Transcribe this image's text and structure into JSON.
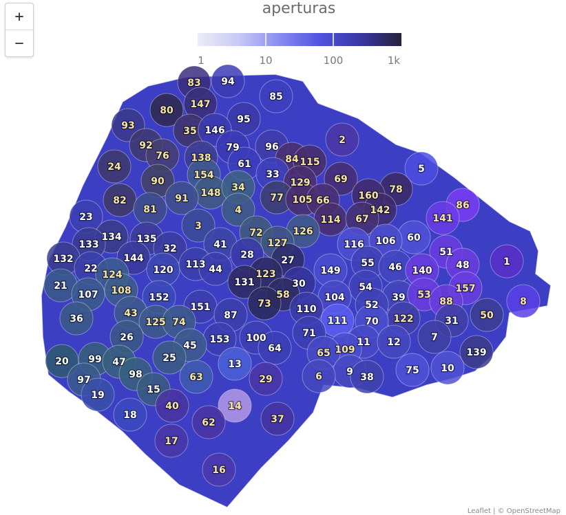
{
  "zoom": {
    "in_label": "+",
    "out_label": "−"
  },
  "legend": {
    "title": "aperturas",
    "ticks": [
      "1",
      "10",
      "100",
      "1k"
    ],
    "colors": [
      "#ececf8",
      "#c9c9f4",
      "#8a8cf2",
      "#4f52de",
      "#3a36a2",
      "#26213a"
    ]
  },
  "attribution": "Leaflet | © OpenStreetMap",
  "map": {
    "boundary_color": "#3c3fc4",
    "districts": [
      {
        "label": "83",
        "fill": "#3b2e7e",
        "tc": "#f7e6a0"
      },
      {
        "label": "94",
        "fill": "#3d3cb4",
        "tc": "#ffffff"
      },
      {
        "label": "85",
        "fill": "#3d3fbe",
        "tc": "#ffffff"
      },
      {
        "label": "147",
        "fill": "#3a2f78",
        "tc": "#f7e6a0"
      },
      {
        "label": "80",
        "fill": "#2f2a4e",
        "tc": "#f7e6a0"
      },
      {
        "label": "95",
        "fill": "#3a3aa8",
        "tc": "#ffffff"
      },
      {
        "label": "93",
        "fill": "#3a3a8c",
        "tc": "#f7e6a0"
      },
      {
        "label": "35",
        "fill": "#3e356a",
        "tc": "#f7e6a0"
      },
      {
        "label": "146",
        "fill": "#3b3ab0",
        "tc": "#ffffff"
      },
      {
        "label": "2",
        "fill": "#4c36a6",
        "tc": "#f7e6a0"
      },
      {
        "label": "92",
        "fill": "#403a6e",
        "tc": "#f7e6a0"
      },
      {
        "label": "79",
        "fill": "#3a3ab4",
        "tc": "#ffffff"
      },
      {
        "label": "96",
        "fill": "#3f3caa",
        "tc": "#ffffff"
      },
      {
        "label": "76",
        "fill": "#454070",
        "tc": "#f7e6a0"
      },
      {
        "label": "138",
        "fill": "#3d3f8e",
        "tc": "#f7e6a0"
      },
      {
        "label": "84",
        "fill": "#4a2f6e",
        "tc": "#f7e6a0"
      },
      {
        "label": "115",
        "fill": "#482e6a",
        "tc": "#f7e6a0"
      },
      {
        "label": "61",
        "fill": "#3c3dba",
        "tc": "#ffffff"
      },
      {
        "label": "24",
        "fill": "#3e3a6a",
        "tc": "#f7e6a0"
      },
      {
        "label": "33",
        "fill": "#3d40bc",
        "tc": "#ffffff"
      },
      {
        "label": "5",
        "fill": "#4a4ee0",
        "tc": "#ffffff"
      },
      {
        "label": "154",
        "fill": "#3f5a8e",
        "tc": "#f7e6a0"
      },
      {
        "label": "90",
        "fill": "#424264",
        "tc": "#f7e6a0"
      },
      {
        "label": "69",
        "fill": "#472e72",
        "tc": "#f7e6a0"
      },
      {
        "label": "129",
        "fill": "#4a2e6e",
        "tc": "#f7e6a0"
      },
      {
        "label": "148",
        "fill": "#3f5c80",
        "tc": "#f7e6a0"
      },
      {
        "label": "34",
        "fill": "#3e6384",
        "tc": "#f7e6a0"
      },
      {
        "label": "78",
        "fill": "#3a2a66",
        "tc": "#f7e6a0"
      },
      {
        "label": "91",
        "fill": "#40508c",
        "tc": "#f7e6a0"
      },
      {
        "label": "160",
        "fill": "#3f2c6a",
        "tc": "#f7e6a0"
      },
      {
        "label": "77",
        "fill": "#3d4070",
        "tc": "#f7e6a0"
      },
      {
        "label": "105",
        "fill": "#4a2f6e",
        "tc": "#f7e6a0"
      },
      {
        "label": "66",
        "fill": "#4a2f70",
        "tc": "#f7e6a0"
      },
      {
        "label": "82",
        "fill": "#3e3a66",
        "tc": "#f7e6a0"
      },
      {
        "label": "86",
        "fill": "#7a3cf2",
        "tc": "#f7e6a0"
      },
      {
        "label": "142",
        "fill": "#402c6c",
        "tc": "#f7e6a0"
      },
      {
        "label": "81",
        "fill": "#3e4c8a",
        "tc": "#f7e6a0"
      },
      {
        "label": "4",
        "fill": "#3e5c84",
        "tc": "#f7e6a0"
      },
      {
        "label": "23",
        "fill": "#3a40b0",
        "tc": "#ffffff"
      },
      {
        "label": "114",
        "fill": "#4a2f6e",
        "tc": "#f7e6a0"
      },
      {
        "label": "67",
        "fill": "#473070",
        "tc": "#f7e6a0"
      },
      {
        "label": "141",
        "fill": "#6a3ce6",
        "tc": "#f7e6a0"
      },
      {
        "label": "3",
        "fill": "#3c4c96",
        "tc": "#f7e6a0"
      },
      {
        "label": "126",
        "fill": "#405a88",
        "tc": "#f7e6a0"
      },
      {
        "label": "72",
        "fill": "#405a7c",
        "tc": "#f7e6a0"
      },
      {
        "label": "134",
        "fill": "#3a3c8a",
        "tc": "#ffffff"
      },
      {
        "label": "135",
        "fill": "#3b3c96",
        "tc": "#ffffff"
      },
      {
        "label": "127",
        "fill": "#3f5680",
        "tc": "#f7e6a0"
      },
      {
        "label": "60",
        "fill": "#4f52d6",
        "tc": "#ffffff"
      },
      {
        "label": "116",
        "fill": "#4d50d2",
        "tc": "#ffffff"
      },
      {
        "label": "106",
        "fill": "#4b4ecc",
        "tc": "#ffffff"
      },
      {
        "label": "133",
        "fill": "#3a3c92",
        "tc": "#ffffff"
      },
      {
        "label": "41",
        "fill": "#3c46a6",
        "tc": "#ffffff"
      },
      {
        "label": "32",
        "fill": "#3b3da0",
        "tc": "#ffffff"
      },
      {
        "label": "28",
        "fill": "#3b3aa8",
        "tc": "#ffffff"
      },
      {
        "label": "51",
        "fill": "#6a3ce0",
        "tc": "#ffffff"
      },
      {
        "label": "1",
        "fill": "#5a2fc8",
        "tc": "#ffffff"
      },
      {
        "label": "132",
        "fill": "#3a3c90",
        "tc": "#ffffff"
      },
      {
        "label": "144",
        "fill": "#3a3a9a",
        "tc": "#ffffff"
      },
      {
        "label": "27",
        "fill": "#2e2c6a",
        "tc": "#ffffff"
      },
      {
        "label": "55",
        "fill": "#3f42b6",
        "tc": "#ffffff"
      },
      {
        "label": "46",
        "fill": "#4346c0",
        "tc": "#ffffff"
      },
      {
        "label": "48",
        "fill": "#6a3cde",
        "tc": "#ffffff"
      },
      {
        "label": "22",
        "fill": "#3a40a8",
        "tc": "#ffffff"
      },
      {
        "label": "120",
        "fill": "#3c48b2",
        "tc": "#ffffff"
      },
      {
        "label": "113",
        "fill": "#3b3eaa",
        "tc": "#ffffff"
      },
      {
        "label": "44",
        "fill": "#3b3eae",
        "tc": "#ffffff"
      },
      {
        "label": "149",
        "fill": "#4a4ed0",
        "tc": "#ffffff"
      },
      {
        "label": "140",
        "fill": "#6a3ce0",
        "tc": "#ffffff"
      },
      {
        "label": "124",
        "fill": "#3c5c8e",
        "tc": "#f7e6a0"
      },
      {
        "label": "123",
        "fill": "#2d2c60",
        "tc": "#f7e6a0"
      },
      {
        "label": "21",
        "fill": "#3a5a8a",
        "tc": "#ffffff"
      },
      {
        "label": "131",
        "fill": "#2e2c62",
        "tc": "#ffffff"
      },
      {
        "label": "30",
        "fill": "#35349a",
        "tc": "#ffffff"
      },
      {
        "label": "54",
        "fill": "#3f42b8",
        "tc": "#ffffff"
      },
      {
        "label": "157",
        "fill": "#6a3ce0",
        "tc": "#f7e6a0"
      },
      {
        "label": "108",
        "fill": "#3d5e8c",
        "tc": "#f7e6a0"
      },
      {
        "label": "107",
        "fill": "#3a5c8c",
        "tc": "#ffffff"
      },
      {
        "label": "152",
        "fill": "#3b4ab8",
        "tc": "#ffffff"
      },
      {
        "label": "58",
        "fill": "#2e2c60",
        "tc": "#f7e6a0"
      },
      {
        "label": "104",
        "fill": "#4649c4",
        "tc": "#ffffff"
      },
      {
        "label": "39",
        "fill": "#4245b8",
        "tc": "#ffffff"
      },
      {
        "label": "53",
        "fill": "#6a3cde",
        "tc": "#f7e6a0"
      },
      {
        "label": "88",
        "fill": "#6a3cdc",
        "tc": "#f7e6a0"
      },
      {
        "label": "8",
        "fill": "#5a40e6",
        "tc": "#f7e6a0"
      },
      {
        "label": "73",
        "fill": "#2c2a5c",
        "tc": "#f7e6a0"
      },
      {
        "label": "52",
        "fill": "#4043b6",
        "tc": "#ffffff"
      },
      {
        "label": "110",
        "fill": "#3a3aa4",
        "tc": "#ffffff"
      },
      {
        "label": "151",
        "fill": "#3b3eae",
        "tc": "#ffffff"
      },
      {
        "label": "43",
        "fill": "#3c5a8c",
        "tc": "#f7e6a0"
      },
      {
        "label": "36",
        "fill": "#3a5a86",
        "tc": "#ffffff"
      },
      {
        "label": "87",
        "fill": "#3b3eac",
        "tc": "#ffffff"
      },
      {
        "label": "50",
        "fill": "#3c3d92",
        "tc": "#f7e6a0"
      },
      {
        "label": "125",
        "fill": "#3d5a88",
        "tc": "#f7e6a0"
      },
      {
        "label": "74",
        "fill": "#3d5a8c",
        "tc": "#f7e6a0"
      },
      {
        "label": "122",
        "fill": "#3f3fa8",
        "tc": "#f7e6a0"
      },
      {
        "label": "111",
        "fill": "#5b5ef0",
        "tc": "#ffffff"
      },
      {
        "label": "70",
        "fill": "#4a4dce",
        "tc": "#ffffff"
      },
      {
        "label": "31",
        "fill": "#3f40a4",
        "tc": "#ffffff"
      },
      {
        "label": "71",
        "fill": "#3c40b2",
        "tc": "#ffffff"
      },
      {
        "label": "26",
        "fill": "#3a5884",
        "tc": "#ffffff"
      },
      {
        "label": "7",
        "fill": "#3e3fa2",
        "tc": "#ffffff"
      },
      {
        "label": "153",
        "fill": "#3b3eb0",
        "tc": "#ffffff"
      },
      {
        "label": "100",
        "fill": "#3b3eb2",
        "tc": "#ffffff"
      },
      {
        "label": "45",
        "fill": "#3c5c8c",
        "tc": "#ffffff"
      },
      {
        "label": "11",
        "fill": "#4649c6",
        "tc": "#ffffff"
      },
      {
        "label": "12",
        "fill": "#4548c0",
        "tc": "#ffffff"
      },
      {
        "label": "64",
        "fill": "#3b3eb4",
        "tc": "#ffffff"
      },
      {
        "label": "139",
        "fill": "#3b3c8a",
        "tc": "#ffffff"
      },
      {
        "label": "109",
        "fill": "#4b4ed0",
        "tc": "#f7e6a0"
      },
      {
        "label": "65",
        "fill": "#4649c4",
        "tc": "#f7e6a0"
      },
      {
        "label": "25",
        "fill": "#3c5c84",
        "tc": "#ffffff"
      },
      {
        "label": "20",
        "fill": "#2f5a72",
        "tc": "#ffffff"
      },
      {
        "label": "99",
        "fill": "#355e7a",
        "tc": "#ffffff"
      },
      {
        "label": "47",
        "fill": "#37607c",
        "tc": "#ffffff"
      },
      {
        "label": "13",
        "fill": "#4a60d6",
        "tc": "#ffffff"
      },
      {
        "label": "75",
        "fill": "#4f52d6",
        "tc": "#ffffff"
      },
      {
        "label": "10",
        "fill": "#4f52d2",
        "tc": "#ffffff"
      },
      {
        "label": "98",
        "fill": "#37607c",
        "tc": "#ffffff"
      },
      {
        "label": "9",
        "fill": "#4649c2",
        "tc": "#ffffff"
      },
      {
        "label": "38",
        "fill": "#3f42ae",
        "tc": "#ffffff"
      },
      {
        "label": "6",
        "fill": "#4548be",
        "tc": "#f7e6a0"
      },
      {
        "label": "63",
        "fill": "#3e5cb0",
        "tc": "#f7e6a0"
      },
      {
        "label": "97",
        "fill": "#3a5a8c",
        "tc": "#ffffff"
      },
      {
        "label": "29",
        "fill": "#4a36a6",
        "tc": "#f7e6a0"
      },
      {
        "label": "15",
        "fill": "#3a5c80",
        "tc": "#ffffff"
      },
      {
        "label": "19",
        "fill": "#3a50a8",
        "tc": "#ffffff"
      },
      {
        "label": "14",
        "fill": "#b49ae6",
        "tc": "#f7e6a0"
      },
      {
        "label": "18",
        "fill": "#3c4ac0",
        "tc": "#ffffff"
      },
      {
        "label": "40",
        "fill": "#4a34a0",
        "tc": "#f7e6a0"
      },
      {
        "label": "37",
        "fill": "#44349e",
        "tc": "#f7e6a0"
      },
      {
        "label": "62",
        "fill": "#4a34a2",
        "tc": "#f7e6a0"
      },
      {
        "label": "17",
        "fill": "#4a36a6",
        "tc": "#f7e6a0"
      },
      {
        "label": "16",
        "fill": "#4a38aa",
        "tc": "#f7e6a0"
      }
    ]
  }
}
